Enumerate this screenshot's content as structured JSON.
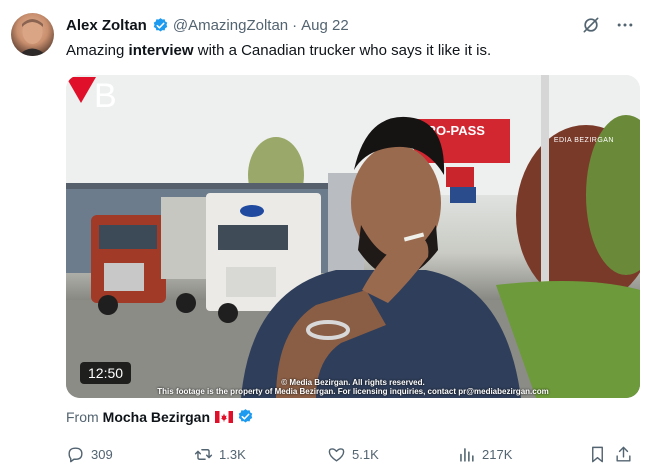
{
  "post": {
    "author_name": "Alex Zoltan",
    "handle": "@AmazingZoltan",
    "separator": "·",
    "date": "Aug 22",
    "text_before": "Amazing ",
    "text_bold": "interview",
    "text_after": " with a Canadian trucker who says it like it is."
  },
  "media": {
    "duration": "12:50",
    "credit_line1": "© Media Bezirgan. All rights reserved.",
    "credit_line2": "This footage is the property of Media Bezirgan. For licensing inquiries, contact pr@mediabezirgan.com",
    "sign_text": "ERO-PASS",
    "watermark_letter": "B",
    "watermark_name": "EDIA BEZIRGAN"
  },
  "source": {
    "from_label": "From",
    "author": "Mocha Bezirgan"
  },
  "metrics": {
    "replies": "309",
    "reposts": "1.3K",
    "likes": "5.1K",
    "views": "217K"
  },
  "colors": {
    "verified": "#1d9bf0",
    "muted": "#536471",
    "text": "#0f1419",
    "brand_red": "#e0102a"
  },
  "icons": {
    "header": [
      "grok-icon",
      "more-icon"
    ],
    "actions": [
      "reply-icon",
      "repost-icon",
      "like-icon",
      "views-icon",
      "bookmark-icon",
      "share-icon"
    ]
  }
}
